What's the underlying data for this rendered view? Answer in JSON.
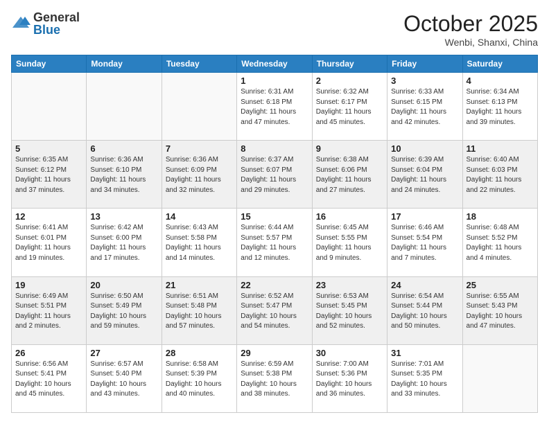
{
  "logo": {
    "general": "General",
    "blue": "Blue"
  },
  "title": {
    "month": "October 2025",
    "location": "Wenbi, Shanxi, China"
  },
  "weekdays": [
    "Sunday",
    "Monday",
    "Tuesday",
    "Wednesday",
    "Thursday",
    "Friday",
    "Saturday"
  ],
  "weeks": [
    [
      {
        "day": "",
        "info": ""
      },
      {
        "day": "",
        "info": ""
      },
      {
        "day": "",
        "info": ""
      },
      {
        "day": "1",
        "info": "Sunrise: 6:31 AM\nSunset: 6:18 PM\nDaylight: 11 hours and 47 minutes."
      },
      {
        "day": "2",
        "info": "Sunrise: 6:32 AM\nSunset: 6:17 PM\nDaylight: 11 hours and 45 minutes."
      },
      {
        "day": "3",
        "info": "Sunrise: 6:33 AM\nSunset: 6:15 PM\nDaylight: 11 hours and 42 minutes."
      },
      {
        "day": "4",
        "info": "Sunrise: 6:34 AM\nSunset: 6:13 PM\nDaylight: 11 hours and 39 minutes."
      }
    ],
    [
      {
        "day": "5",
        "info": "Sunrise: 6:35 AM\nSunset: 6:12 PM\nDaylight: 11 hours and 37 minutes."
      },
      {
        "day": "6",
        "info": "Sunrise: 6:36 AM\nSunset: 6:10 PM\nDaylight: 11 hours and 34 minutes."
      },
      {
        "day": "7",
        "info": "Sunrise: 6:36 AM\nSunset: 6:09 PM\nDaylight: 11 hours and 32 minutes."
      },
      {
        "day": "8",
        "info": "Sunrise: 6:37 AM\nSunset: 6:07 PM\nDaylight: 11 hours and 29 minutes."
      },
      {
        "day": "9",
        "info": "Sunrise: 6:38 AM\nSunset: 6:06 PM\nDaylight: 11 hours and 27 minutes."
      },
      {
        "day": "10",
        "info": "Sunrise: 6:39 AM\nSunset: 6:04 PM\nDaylight: 11 hours and 24 minutes."
      },
      {
        "day": "11",
        "info": "Sunrise: 6:40 AM\nSunset: 6:03 PM\nDaylight: 11 hours and 22 minutes."
      }
    ],
    [
      {
        "day": "12",
        "info": "Sunrise: 6:41 AM\nSunset: 6:01 PM\nDaylight: 11 hours and 19 minutes."
      },
      {
        "day": "13",
        "info": "Sunrise: 6:42 AM\nSunset: 6:00 PM\nDaylight: 11 hours and 17 minutes."
      },
      {
        "day": "14",
        "info": "Sunrise: 6:43 AM\nSunset: 5:58 PM\nDaylight: 11 hours and 14 minutes."
      },
      {
        "day": "15",
        "info": "Sunrise: 6:44 AM\nSunset: 5:57 PM\nDaylight: 11 hours and 12 minutes."
      },
      {
        "day": "16",
        "info": "Sunrise: 6:45 AM\nSunset: 5:55 PM\nDaylight: 11 hours and 9 minutes."
      },
      {
        "day": "17",
        "info": "Sunrise: 6:46 AM\nSunset: 5:54 PM\nDaylight: 11 hours and 7 minutes."
      },
      {
        "day": "18",
        "info": "Sunrise: 6:48 AM\nSunset: 5:52 PM\nDaylight: 11 hours and 4 minutes."
      }
    ],
    [
      {
        "day": "19",
        "info": "Sunrise: 6:49 AM\nSunset: 5:51 PM\nDaylight: 11 hours and 2 minutes."
      },
      {
        "day": "20",
        "info": "Sunrise: 6:50 AM\nSunset: 5:49 PM\nDaylight: 10 hours and 59 minutes."
      },
      {
        "day": "21",
        "info": "Sunrise: 6:51 AM\nSunset: 5:48 PM\nDaylight: 10 hours and 57 minutes."
      },
      {
        "day": "22",
        "info": "Sunrise: 6:52 AM\nSunset: 5:47 PM\nDaylight: 10 hours and 54 minutes."
      },
      {
        "day": "23",
        "info": "Sunrise: 6:53 AM\nSunset: 5:45 PM\nDaylight: 10 hours and 52 minutes."
      },
      {
        "day": "24",
        "info": "Sunrise: 6:54 AM\nSunset: 5:44 PM\nDaylight: 10 hours and 50 minutes."
      },
      {
        "day": "25",
        "info": "Sunrise: 6:55 AM\nSunset: 5:43 PM\nDaylight: 10 hours and 47 minutes."
      }
    ],
    [
      {
        "day": "26",
        "info": "Sunrise: 6:56 AM\nSunset: 5:41 PM\nDaylight: 10 hours and 45 minutes."
      },
      {
        "day": "27",
        "info": "Sunrise: 6:57 AM\nSunset: 5:40 PM\nDaylight: 10 hours and 43 minutes."
      },
      {
        "day": "28",
        "info": "Sunrise: 6:58 AM\nSunset: 5:39 PM\nDaylight: 10 hours and 40 minutes."
      },
      {
        "day": "29",
        "info": "Sunrise: 6:59 AM\nSunset: 5:38 PM\nDaylight: 10 hours and 38 minutes."
      },
      {
        "day": "30",
        "info": "Sunrise: 7:00 AM\nSunset: 5:36 PM\nDaylight: 10 hours and 36 minutes."
      },
      {
        "day": "31",
        "info": "Sunrise: 7:01 AM\nSunset: 5:35 PM\nDaylight: 10 hours and 33 minutes."
      },
      {
        "day": "",
        "info": ""
      }
    ]
  ]
}
